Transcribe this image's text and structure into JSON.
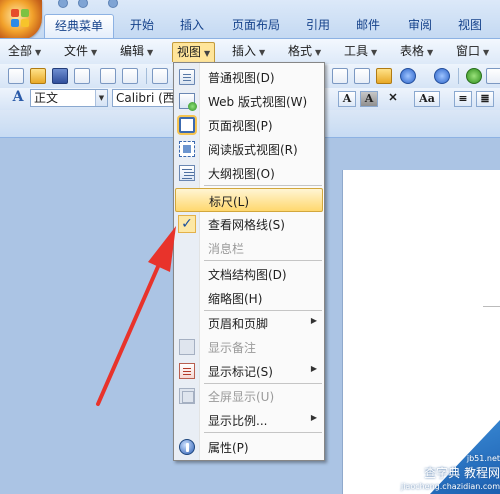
{
  "tabs": [
    {
      "label": "经典菜单",
      "active": true
    },
    {
      "label": "开始",
      "active": false
    },
    {
      "label": "插入",
      "active": false
    },
    {
      "label": "页面布局",
      "active": false
    },
    {
      "label": "引用",
      "active": false
    },
    {
      "label": "邮件",
      "active": false
    },
    {
      "label": "审阅",
      "active": false
    },
    {
      "label": "视图",
      "active": false
    }
  ],
  "menubar": [
    {
      "label": "全部",
      "open": false
    },
    {
      "label": "文件",
      "open": false
    },
    {
      "label": "编辑",
      "open": false
    },
    {
      "label": "视图",
      "open": true
    },
    {
      "label": "插入",
      "open": false
    },
    {
      "label": "格式",
      "open": false
    },
    {
      "label": "工具",
      "open": false
    },
    {
      "label": "表格",
      "open": false
    },
    {
      "label": "窗口",
      "open": false
    }
  ],
  "formatting": {
    "style_value": "正文",
    "font_value": "Calibri (西文",
    "style_icon": "style-a-icon"
  },
  "view_menu": {
    "items": [
      {
        "label": "普通视图(D)",
        "icon": "normal-view-icon",
        "enabled": true,
        "submenu": false
      },
      {
        "label": "Web 版式视图(W)",
        "icon": "web-layout-icon",
        "enabled": true,
        "submenu": false
      },
      {
        "label": "页面视图(P)",
        "icon": "print-layout-icon",
        "enabled": true,
        "submenu": false,
        "selected": true
      },
      {
        "label": "阅读版式视图(R)",
        "icon": "reading-layout-icon",
        "enabled": true,
        "submenu": false
      },
      {
        "label": "大纲视图(O)",
        "icon": "outline-view-icon",
        "enabled": true,
        "submenu": false
      },
      {
        "label": "标尺(L)",
        "icon": "",
        "enabled": true,
        "submenu": false,
        "highlighted": true
      },
      {
        "label": "查看网格线(S)",
        "icon": "checkmark-icon",
        "enabled": true,
        "submenu": false,
        "checked": true
      },
      {
        "label": "消息栏",
        "icon": "",
        "enabled": false,
        "submenu": false
      },
      {
        "label": "文档结构图(D)",
        "icon": "",
        "enabled": true,
        "submenu": false
      },
      {
        "label": "缩略图(H)",
        "icon": "",
        "enabled": true,
        "submenu": false
      },
      {
        "label": "页眉和页脚",
        "icon": "",
        "enabled": true,
        "submenu": true
      },
      {
        "label": "显示备注",
        "icon": "notes-icon",
        "enabled": false,
        "submenu": false
      },
      {
        "label": "显示标记(S)",
        "icon": "markup-icon",
        "enabled": true,
        "submenu": true
      },
      {
        "label": "全屏显示(U)",
        "icon": "fullscreen-icon",
        "enabled": false,
        "submenu": false
      },
      {
        "label": "显示比例...",
        "icon": "",
        "enabled": true,
        "submenu": true
      },
      {
        "label": "属性(P)",
        "icon": "properties-icon",
        "enabled": true,
        "submenu": false
      }
    ]
  },
  "watermark": {
    "line1": "查字典 教程网",
    "line2": "jiaocheng.chazidian.com",
    "corner": "jb51.net"
  },
  "colors": {
    "accent_highlight": "#ffd86e",
    "ribbon_blue": "#c4d9f2",
    "arrow_red": "#e8332b"
  }
}
